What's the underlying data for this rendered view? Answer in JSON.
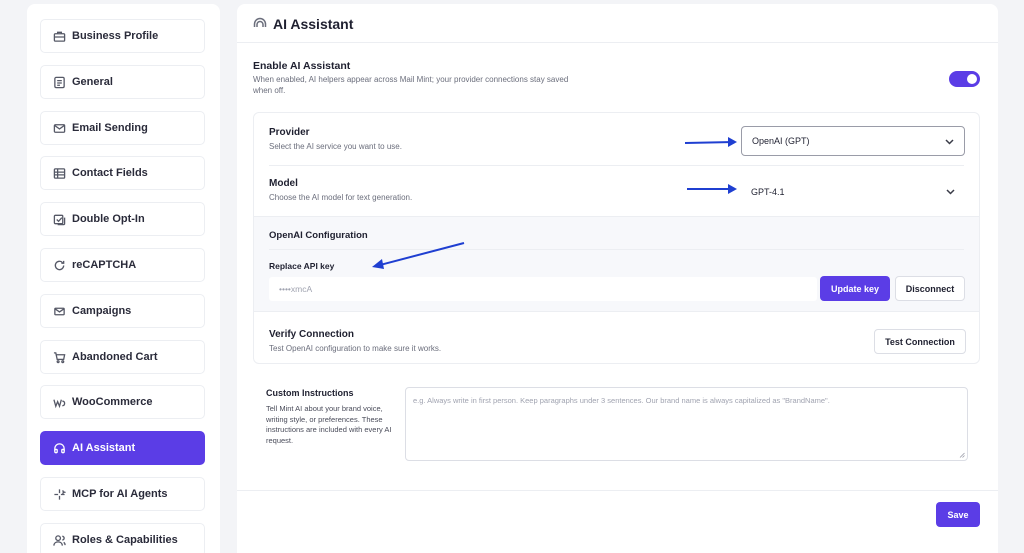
{
  "sidebar": {
    "items": [
      {
        "label": "Business Profile",
        "icon": "briefcase-icon"
      },
      {
        "label": "General",
        "icon": "document-icon"
      },
      {
        "label": "Email Sending",
        "icon": "mail-icon"
      },
      {
        "label": "Contact Fields",
        "icon": "grid-icon"
      },
      {
        "label": "Double Opt-In",
        "icon": "double-opt-in-icon"
      },
      {
        "label": "reCAPTCHA",
        "icon": "recaptcha-icon"
      },
      {
        "label": "Campaigns",
        "icon": "envelope-icon"
      },
      {
        "label": "Abandoned Cart",
        "icon": "cart-icon"
      },
      {
        "label": "WooCommerce",
        "icon": "woocommerce-icon"
      },
      {
        "label": "AI Assistant",
        "icon": "ai-assistant-icon",
        "active": true
      },
      {
        "label": "MCP for AI Agents",
        "icon": "sparkle-icon"
      },
      {
        "label": "Roles & Capabilities",
        "icon": "users-icon"
      }
    ]
  },
  "main": {
    "title": "AI Assistant",
    "enable": {
      "label": "Enable AI Assistant",
      "description": "When enabled, AI helpers appear across Mail Mint; your provider connections stay saved when off.",
      "on": true
    },
    "provider": {
      "label": "Provider",
      "description": "Select the AI service you want to use.",
      "value": "OpenAI (GPT)"
    },
    "model": {
      "label": "Model",
      "description": "Choose the AI model for text generation.",
      "value": "GPT-4.1"
    },
    "config": {
      "title": "OpenAI Configuration",
      "api_label": "Replace API key",
      "api_placeholder": "••••xmcA",
      "update_button": "Update key",
      "disconnect_button": "Disconnect"
    },
    "verify": {
      "label": "Verify Connection",
      "description": "Test OpenAI configuration to make sure it works.",
      "button": "Test Connection"
    },
    "custom": {
      "label": "Custom Instructions",
      "description": "Tell Mint AI about your brand voice, writing style, or preferences. These instructions are included with every AI request.",
      "placeholder": "e.g. Always write in first person. Keep paragraphs under 3 sentences. Our brand name is always capitalized as \"BrandName\"."
    },
    "save_button": "Save"
  },
  "colors": {
    "accent": "#5b3de6",
    "annotation_arrow": "#1f3fd1"
  }
}
